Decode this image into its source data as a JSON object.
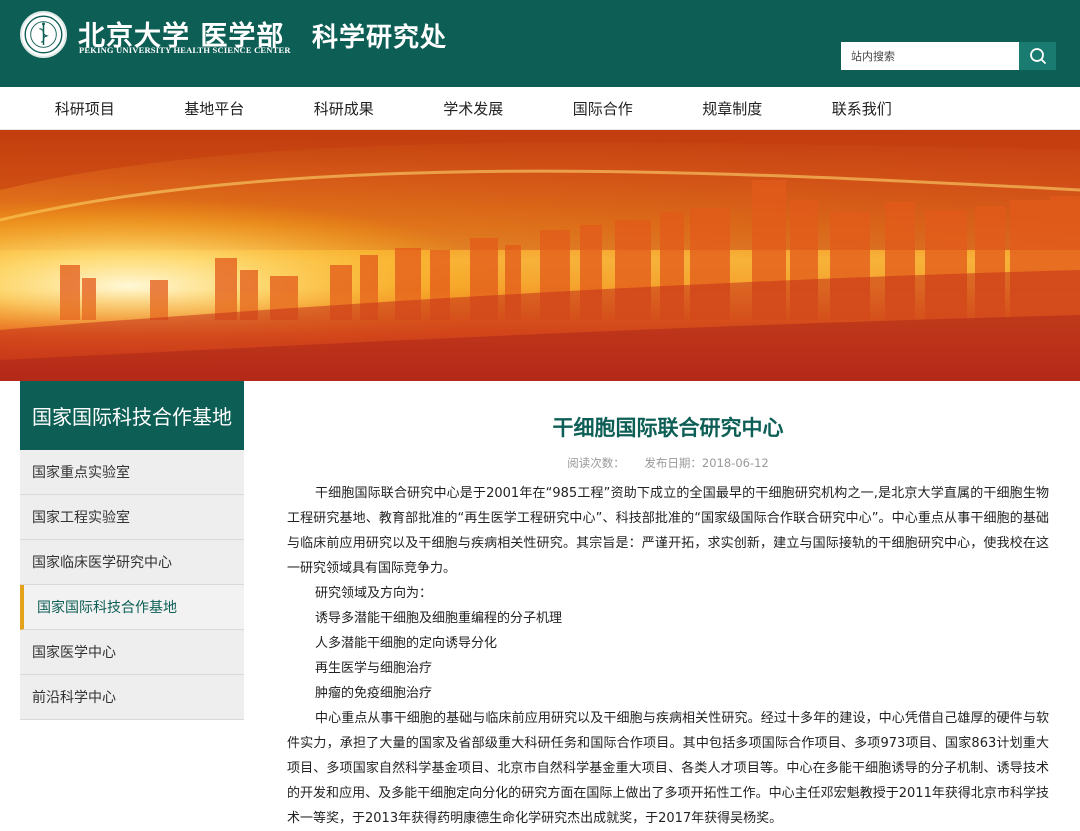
{
  "header": {
    "brand_cn": "北京大学 医学部",
    "brand_en": "PEKING UNIVERSITY HEALTH SCIENCE CENTER",
    "dept_title": "科学研究处",
    "search_placeholder": "站内搜索",
    "primary_color": "#0d5e55"
  },
  "nav": {
    "items": [
      "科研项目",
      "基地平台",
      "科研成果",
      "学术发展",
      "国际合作",
      "规章制度",
      "联系我们"
    ]
  },
  "sidebar": {
    "title": "国家国际科技合作基地",
    "items": [
      {
        "label": "国家重点实验室"
      },
      {
        "label": "国家工程实验室"
      },
      {
        "label": "国家临床医学研究中心"
      },
      {
        "label": "国家国际科技合作基地"
      },
      {
        "label": "国家医学中心"
      },
      {
        "label": "前沿科学中心"
      }
    ],
    "active_index": 3,
    "accent_color": "#e3a21a"
  },
  "article": {
    "title": "干细胞国际联合研究中心",
    "views_label": "阅读次数：",
    "date_label": "发布日期：2018-06-12",
    "paragraphs": [
      "干细胞国际联合研究中心是于2001年在“985工程”资助下成立的全国最早的干细胞研究机构之一,是北京大学直属的干细胞生物工程研究基地、教育部批准的“再生医学工程研究中心”、科技部批准的“国家级国际合作联合研究中心”。中心重点从事干细胞的基础与临床前应用研究以及干细胞与疾病相关性研究。其宗旨是：严谨开拓，求实创新，建立与国际接轨的干细胞研究中心，使我校在这一研究领域具有国际竞争力。",
      "研究领域及方向为：",
      "诱导多潜能干细胞及细胞重编程的分子机理",
      "人多潜能干细胞的定向诱导分化",
      "再生医学与细胞治疗",
      "肿瘤的免疫细胞治疗",
      "中心重点从事干细胞的基础与临床前应用研究以及干细胞与疾病相关性研究。经过十多年的建设，中心凭借自己雄厚的硬件与软件实力，承担了大量的国家及省部级重大科研任务和国际合作项目。其中包括多项国际合作项目、多项973项目、国家863计划重大项目、多项国家自然科学基金项目、北京市自然科学基金重大项目、各类人才项目等。中心在多能干细胞诱导的分子机制、诱导技术的开发和应用、及多能干细胞定向分化的研究方面在国际上做出了多项开拓性工作。中心主任邓宏魁教授于2011年获得北京市科学技术一等奖，于2013年获得药明康德生命化学研究杰出成就奖，于2017年获得吴杨奖。"
    ]
  }
}
